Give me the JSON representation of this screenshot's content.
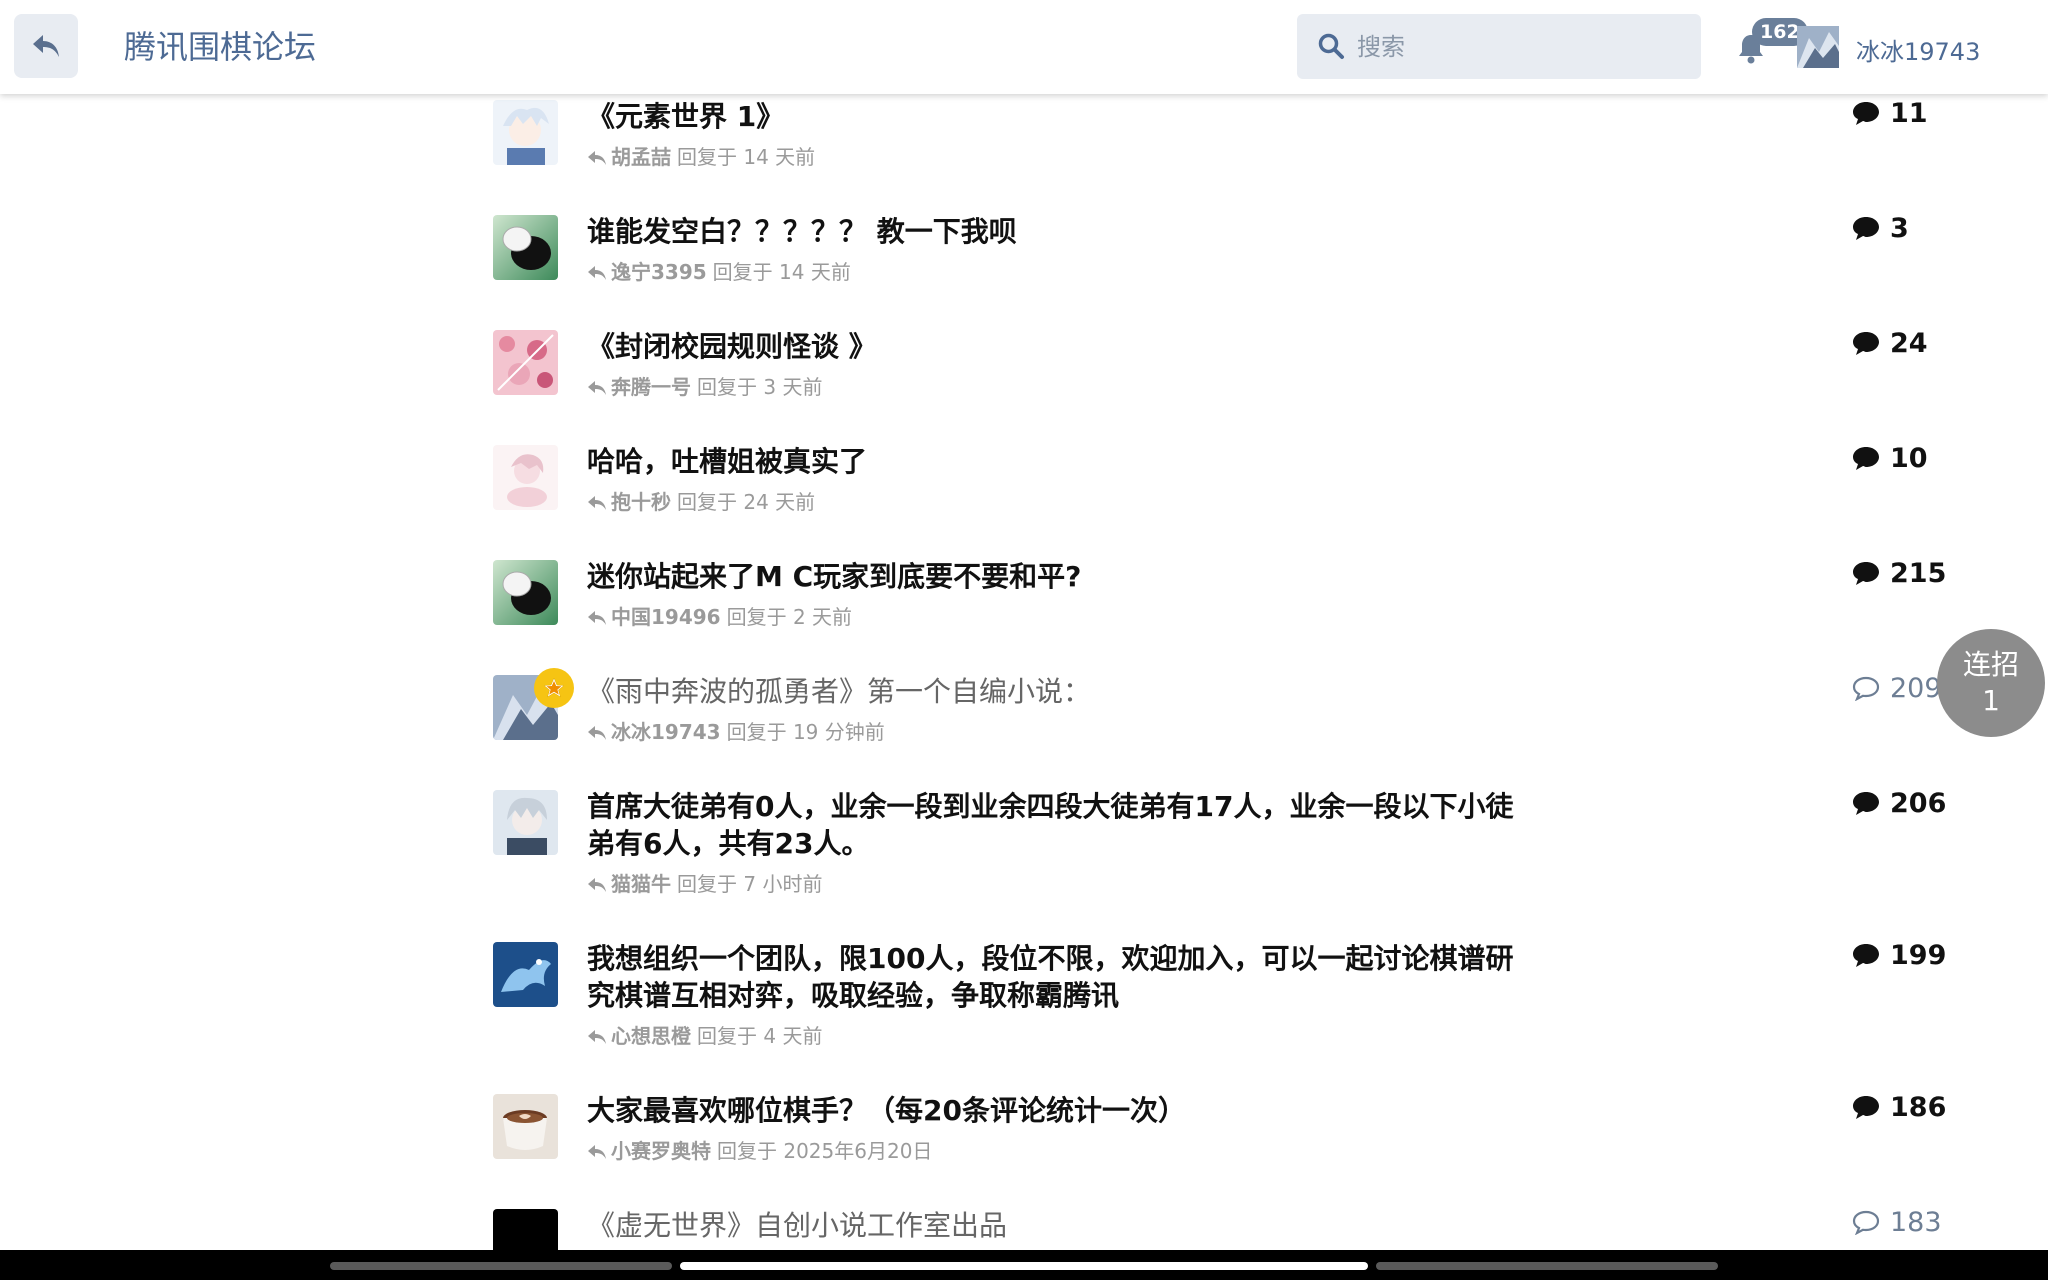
{
  "header": {
    "title": "腾讯围棋论坛",
    "search_placeholder": "搜索",
    "notification_count": "162",
    "username": "冰冰19743"
  },
  "topics": [
    {
      "title": "《元素世界 1》",
      "author": "胡孟喆",
      "reply_text": "回复于 14 天前",
      "count": "11",
      "read": false,
      "avatar": "anime-white-hair"
    },
    {
      "title": "谁能发空白？？？？？ 教一下我呗",
      "author": "逸宁3395",
      "reply_text": "回复于 14 天前",
      "count": "3",
      "read": false,
      "avatar": "go-stone"
    },
    {
      "title": "《封闭校园规则怪谈 》",
      "author": "奔腾一号",
      "reply_text": "回复于 3 天前",
      "count": "24",
      "read": false,
      "avatar": "pink-pattern"
    },
    {
      "title": "哈哈，吐槽姐被真实了",
      "author": "抱十秒",
      "reply_text": "回复于 24 天前",
      "count": "10",
      "read": false,
      "avatar": "anime-pink"
    },
    {
      "title": "迷你站起来了M C玩家到底要不要和平?",
      "author": "中国19496",
      "reply_text": "回复于 2 天前",
      "count": "215",
      "read": false,
      "avatar": "go-stone"
    },
    {
      "title": "《雨中奔波的孤勇者》第一个自编小说：",
      "author": "冰冰19743",
      "reply_text": "回复于 19 分钟前",
      "count": "209",
      "read": true,
      "avatar": "anime-ice",
      "starred": true
    },
    {
      "title": "首席大徒弟有0人，业余一段到业余四段大徒弟有17人，业余一段以下小徒弟有6人，共有23人。",
      "author": "猫猫牛",
      "reply_text": "回复于 7 小时前",
      "count": "206",
      "read": false,
      "avatar": "anime-silver"
    },
    {
      "title": "我想组织一个团队，限100人，段位不限，欢迎加入，可以一起讨论棋谱研究棋谱互相对弈，吸取经验，争取称霸腾讯",
      "author": "心想思橙",
      "reply_text": "回复于 4 天前",
      "count": "199",
      "read": false,
      "avatar": "blue-dragon"
    },
    {
      "title": "大家最喜欢哪位棋手？（每20条评论统计一次）",
      "author": "小赛罗奥特",
      "reply_text": "回复于 2025年6月20日",
      "count": "186",
      "read": false,
      "avatar": "coffee-cup"
    },
    {
      "title": "《虚无世界》自创小说工作室出品",
      "author": "",
      "reply_text": "",
      "count": "183",
      "read": true,
      "avatar": "black-square"
    }
  ],
  "combo_button": {
    "line1": "连招",
    "line2": "1"
  },
  "colors": {
    "accent": "#4d6a94",
    "star": "#f6c413",
    "read_count": "#6d7e94"
  }
}
